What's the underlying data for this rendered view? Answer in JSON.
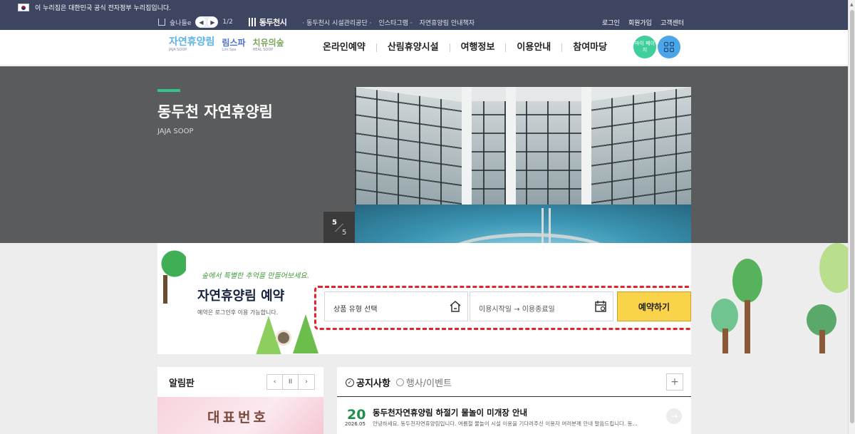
{
  "gov_banner": {
    "text": "이 누리집은 대한민국 공식 전자정부 누리집입니다."
  },
  "util_bar": {
    "family_site": "숲나들e",
    "page_indicator": "1/2",
    "city_logo": "동두천시",
    "links": [
      "· 동두천시 시설관리공단 ·",
      "인스타그램 ·",
      "자연휴양림 안내책자"
    ],
    "right_links": [
      "로그인",
      "회원가입",
      "고객센터"
    ]
  },
  "header": {
    "logos": [
      {
        "text": "자연휴양림",
        "sub": "JAJA SOOP"
      },
      {
        "text": "림스파",
        "sub": "Lim Spa"
      },
      {
        "text": "치유의숲",
        "sub": "HEAL SOOP"
      }
    ],
    "nav": [
      "온라인예약",
      "산림휴양시설",
      "여행정보",
      "이용안내",
      "참여마당"
    ],
    "mypage": "마이 페이지"
  },
  "hero": {
    "title": "동두천 자연휴양림",
    "subtitle": "JAJA SOOP",
    "slide_current": "5",
    "slide_total": "5",
    "prev": "⟵",
    "next": "⟶"
  },
  "reservation": {
    "script_text": "숲에서 특별한 추억을 만들어보세요.",
    "title": "자연휴양림 예약",
    "note": "예약은 로그인후 이용 가능합니다.",
    "type_placeholder": "상품 유형 선택",
    "date_placeholder": "이용시작일 → 이용종료일",
    "button": "예약하기"
  },
  "board": {
    "title": "알림판",
    "controls": [
      "‹",
      "II",
      "›"
    ],
    "banner_text": "대표번호"
  },
  "notice": {
    "tab_active": "공지사항",
    "tab_other": "행사/이벤트",
    "more": "+",
    "item": {
      "day": "20",
      "year_month": "2026.05",
      "title": "동두천자연휴양림 하절기 물놀이 미개장 안내",
      "desc": "안녕하세요. 동두천자연휴양림입니다. 여름철 물놀이 시설 이용을 기다려주신 이용자 여러분께 안내 말씀드립니다. 동..."
    }
  },
  "colors": {
    "topbar": "#3d4560",
    "accent_green": "#2fc58b",
    "reserve_yellow": "#f9d44a",
    "dashed_red": "#e2252c",
    "hero_gray": "#595b5c"
  }
}
